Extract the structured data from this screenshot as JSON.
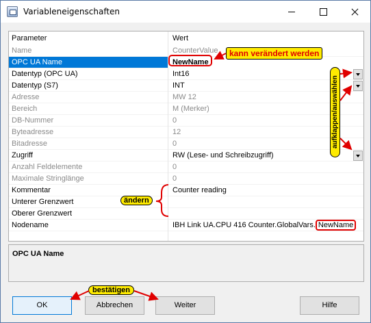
{
  "window": {
    "title": "Variableneigenschaften"
  },
  "grid": {
    "header": {
      "param": "Parameter",
      "value": "Wert"
    },
    "rows": [
      {
        "name": "Name",
        "value": "CounterValue"
      },
      {
        "name": "OPC UA Name",
        "value": "NewName"
      },
      {
        "name": "Datentyp (OPC UA)",
        "value": "Int16"
      },
      {
        "name": "Datentyp (S7)",
        "value": "INT"
      },
      {
        "name": "Adresse",
        "value": "MW 12"
      },
      {
        "name": "Bereich",
        "value": "M (Merker)"
      },
      {
        "name": "DB-Nummer",
        "value": "0"
      },
      {
        "name": "Byteadresse",
        "value": "12"
      },
      {
        "name": "Bitadresse",
        "value": "0"
      },
      {
        "name": "Zugriff",
        "value": "RW (Lese- und Schreibzugriff)"
      },
      {
        "name": "Anzahl Feldelemente",
        "value": "0"
      },
      {
        "name": "Maximale Stringlänge",
        "value": "0"
      },
      {
        "name": "Kommentar",
        "value": "Counter reading"
      },
      {
        "name": "Unterer Grenzwert",
        "value": ""
      },
      {
        "name": "Oberer Grenzwert",
        "value": ""
      },
      {
        "name": "Nodename",
        "value": "IBH Link UA.CPU 416 Counter.GlobalVars.",
        "value_highlight": "NewName"
      }
    ]
  },
  "description": {
    "title": "OPC UA Name"
  },
  "buttons": {
    "ok": "OK",
    "cancel": "Abbrechen",
    "next": "Weiter",
    "help": "Hilfe"
  },
  "annotations": {
    "changeable": "kann verändert werden",
    "expand_select": "aufklappen/auswählen",
    "change": "ändern",
    "confirm": "bestätigen"
  },
  "colors": {
    "selection": "#0078d7",
    "callout": "#ffeb00",
    "marker": "#e00000"
  }
}
